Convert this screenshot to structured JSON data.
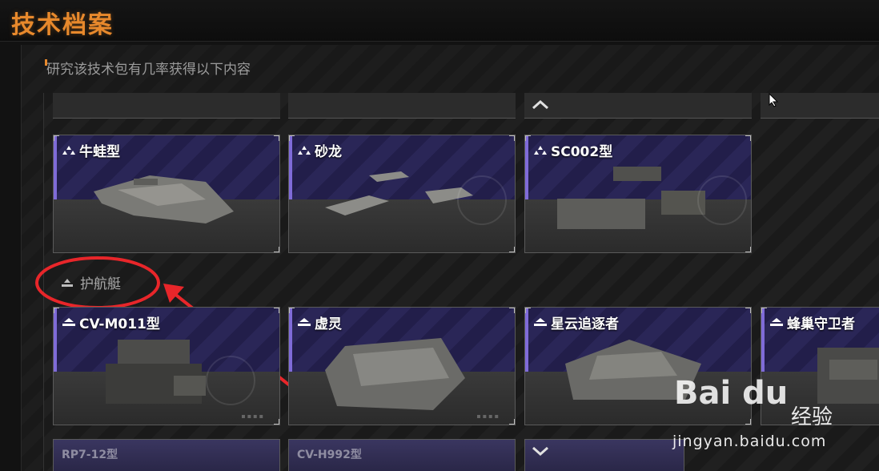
{
  "header": {
    "title": "技术档案"
  },
  "subtitle": "研究该技术包有几率获得以下内容",
  "scroll": {
    "up_icon": "chevron-up-icon",
    "down_icon": "chevron-down-icon"
  },
  "colors": {
    "accent": "#e8892c",
    "card_purple": "#221e4a",
    "annotation_red": "#e8262a"
  },
  "row1_cards": [
    {
      "name": "牛蛙型",
      "icon": "tier-icon"
    },
    {
      "name": "砂龙",
      "icon": "tier-icon"
    },
    {
      "name": "SC002型",
      "icon": "tier-icon"
    }
  ],
  "section": {
    "label": "护航艇",
    "icon": "corvette-class-icon"
  },
  "row2_cards": [
    {
      "name": "CV-M011型",
      "icon": "tier-icon"
    },
    {
      "name": "虚灵",
      "icon": "tier-icon"
    },
    {
      "name": "星云追逐者",
      "icon": "tier-icon"
    },
    {
      "name": "蜂巢守卫者",
      "icon": "tier-icon"
    }
  ],
  "row3_cards_partial": [
    {
      "name": "RP7-12型"
    },
    {
      "name": "CV-H992型"
    }
  ],
  "watermark": {
    "logo": "Bai du",
    "text": "经验",
    "url": "jingyan.baidu.com"
  }
}
